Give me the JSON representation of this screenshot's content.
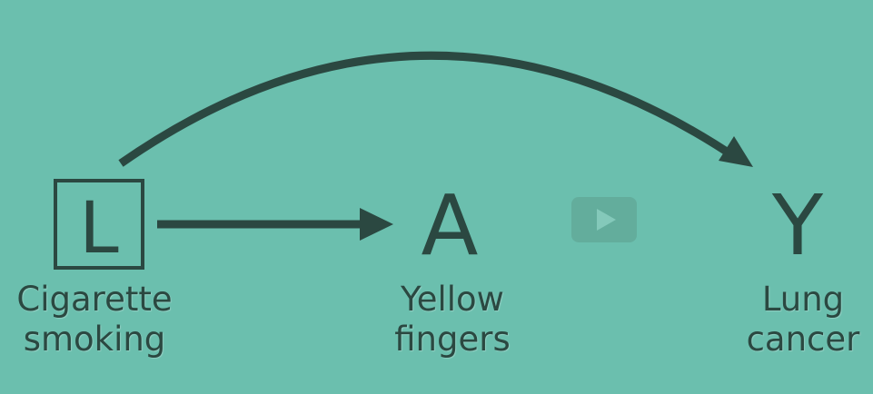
{
  "diagram": {
    "nodes": [
      {
        "id": "L",
        "letter": "L",
        "caption_line1": "Cigarette",
        "caption_line2": "smoking",
        "boxed": true
      },
      {
        "id": "A",
        "letter": "A",
        "caption_line1": "Yellow",
        "caption_line2": "fingers",
        "boxed": false
      },
      {
        "id": "Y",
        "letter": "Y",
        "caption_line1": "Lung",
        "caption_line2": "cancer",
        "boxed": false
      }
    ],
    "edges": [
      {
        "from": "L",
        "to": "A",
        "style": "straight"
      },
      {
        "from": "L",
        "to": "Y",
        "style": "curved"
      }
    ]
  },
  "colors": {
    "background": "#6bbfae",
    "ink": "#2b4841",
    "play_overlay": "#5a9688"
  },
  "player": {
    "icon": "play-icon"
  }
}
